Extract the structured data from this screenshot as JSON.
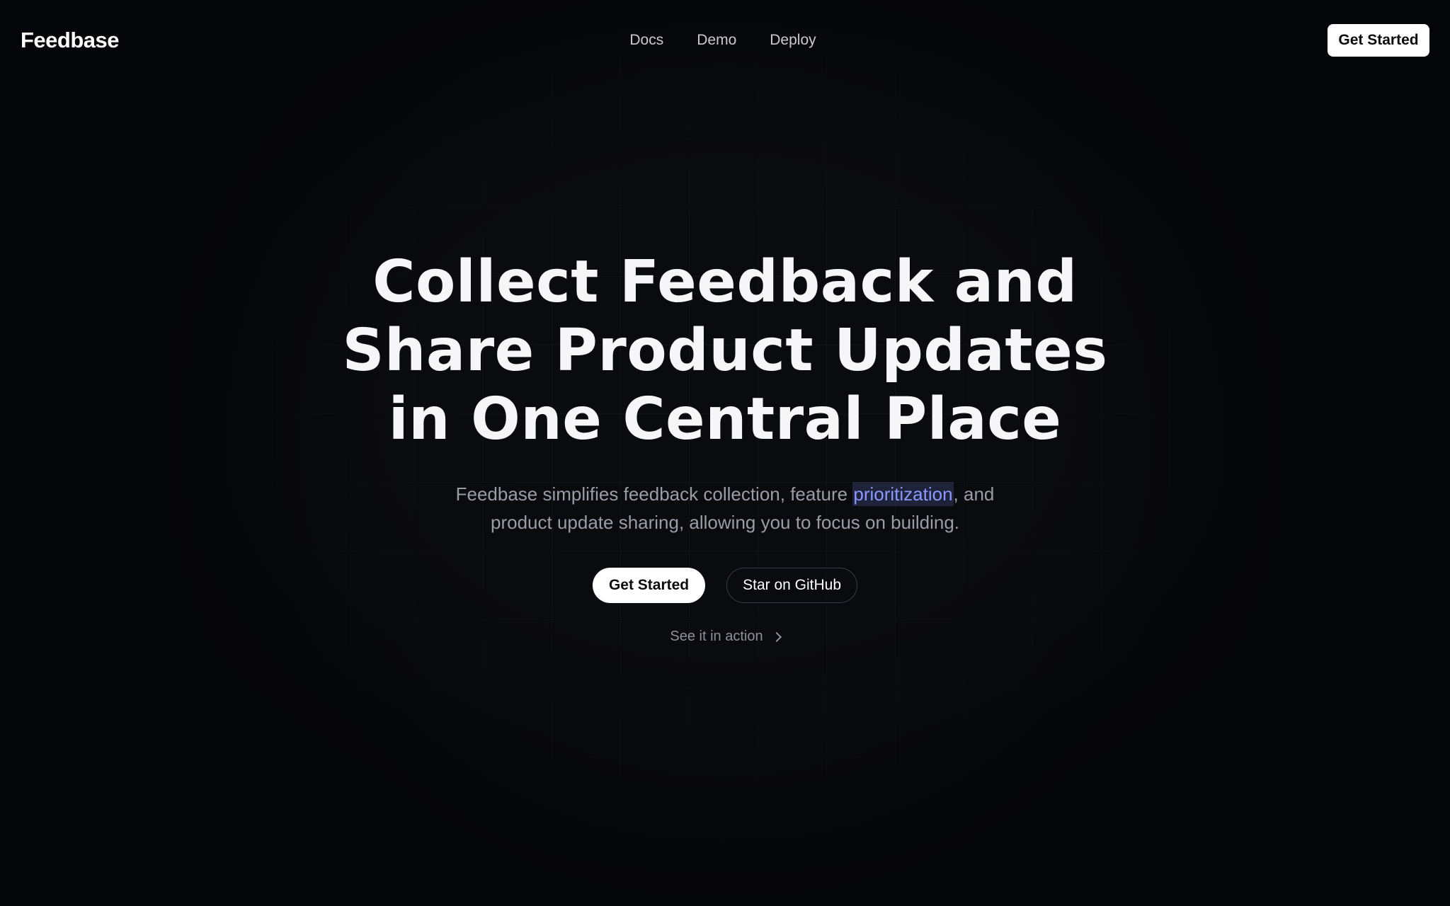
{
  "brand": {
    "name": "Feedbase"
  },
  "nav": {
    "links": [
      {
        "label": "Docs"
      },
      {
        "label": "Demo"
      },
      {
        "label": "Deploy"
      }
    ],
    "cta_label": "Get Started"
  },
  "hero": {
    "headline_lines": [
      "Collect Feedback and",
      "Share Product Updates",
      "in One Central Place"
    ],
    "subtitle": {
      "line1_before": "Feedbase simplifies feedback collection, feature ",
      "line1_highlight": "prioritization",
      "line1_after": ", and",
      "line2": "product update sharing, allowing you to focus on building."
    },
    "primary_button": "Get Started",
    "secondary_button": "Star on GitHub",
    "see_action_link": "See it in action",
    "see_action_icon": "chevron-right-icon"
  },
  "colors": {
    "background": "#0a0b0f",
    "highlight_text": "#8a98ff",
    "muted_text": "#9a9ca6",
    "button_bg": "#ffffff"
  }
}
